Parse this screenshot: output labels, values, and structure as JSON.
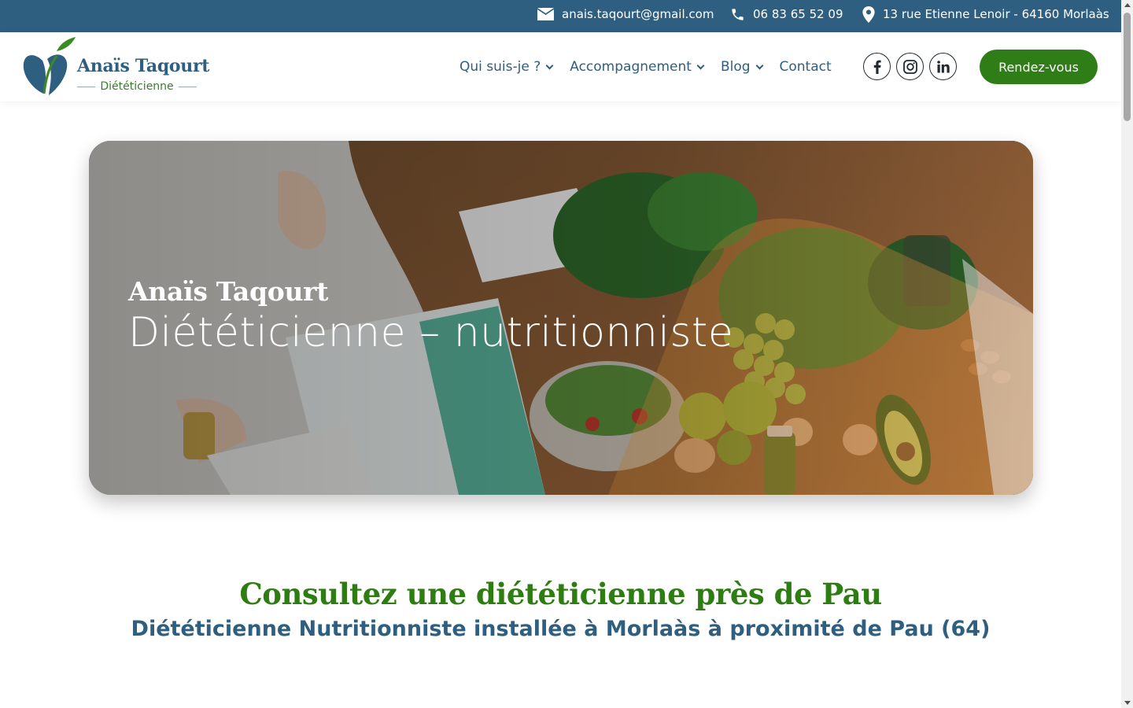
{
  "topbar": {
    "email": "anais.taqourt@gmail.com",
    "phone": "06 83 65 52 09",
    "address": "13 rue Etienne Lenoir - 64160 Morlaàs"
  },
  "logo": {
    "name": "Anaïs Taqourt",
    "subtitle": "Diététicienne"
  },
  "nav": {
    "items": [
      {
        "label": "Qui suis-je ?",
        "dropdown": true
      },
      {
        "label": "Accompagnement",
        "dropdown": true
      },
      {
        "label": "Blog",
        "dropdown": true
      },
      {
        "label": "Contact",
        "dropdown": false
      }
    ],
    "social": [
      "facebook-icon",
      "instagram-icon",
      "linkedin-icon"
    ],
    "cta_label": "Rendez-vous"
  },
  "hero": {
    "title": "Anaïs Taqourt",
    "subtitle": "Diététicienne – nutritionniste"
  },
  "intro": {
    "title": "Consultez une diététicienne près de Pau",
    "subtitle": "Diététicienne Nutritionniste installée à Morlaàs à proximité de Pau (64)"
  },
  "colors": {
    "primary_blue": "#2f5f80",
    "accent_green": "#2f7d17",
    "title_green": "#2e7d12"
  }
}
